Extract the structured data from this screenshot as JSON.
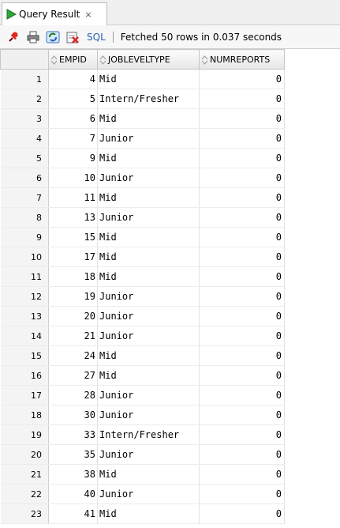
{
  "tab": {
    "title": "Query Result",
    "close_symbol": "×",
    "run_icon": "green-play-icon"
  },
  "toolbar": {
    "icons": [
      "pin-icon",
      "print-icon",
      "refresh-icon",
      "export-icon"
    ],
    "sql_label": "SQL",
    "status": "Fetched 50 rows in 0.037 seconds"
  },
  "columns": [
    "EMPID",
    "JOBLEVELTYPE",
    "NUMREPORTS"
  ],
  "rows": [
    {
      "n": "1",
      "empid": "4",
      "job": "Mid",
      "num": "0"
    },
    {
      "n": "2",
      "empid": "5",
      "job": "Intern/Fresher",
      "num": "0"
    },
    {
      "n": "3",
      "empid": "6",
      "job": "Mid",
      "num": "0"
    },
    {
      "n": "4",
      "empid": "7",
      "job": "Junior",
      "num": "0"
    },
    {
      "n": "5",
      "empid": "9",
      "job": "Mid",
      "num": "0"
    },
    {
      "n": "6",
      "empid": "10",
      "job": "Junior",
      "num": "0"
    },
    {
      "n": "7",
      "empid": "11",
      "job": "Mid",
      "num": "0"
    },
    {
      "n": "8",
      "empid": "13",
      "job": "Junior",
      "num": "0"
    },
    {
      "n": "9",
      "empid": "15",
      "job": "Mid",
      "num": "0"
    },
    {
      "n": "10",
      "empid": "17",
      "job": "Mid",
      "num": "0"
    },
    {
      "n": "11",
      "empid": "18",
      "job": "Mid",
      "num": "0"
    },
    {
      "n": "12",
      "empid": "19",
      "job": "Junior",
      "num": "0"
    },
    {
      "n": "13",
      "empid": "20",
      "job": "Junior",
      "num": "0"
    },
    {
      "n": "14",
      "empid": "21",
      "job": "Junior",
      "num": "0"
    },
    {
      "n": "15",
      "empid": "24",
      "job": "Mid",
      "num": "0"
    },
    {
      "n": "16",
      "empid": "27",
      "job": "Mid",
      "num": "0"
    },
    {
      "n": "17",
      "empid": "28",
      "job": "Junior",
      "num": "0"
    },
    {
      "n": "18",
      "empid": "30",
      "job": "Junior",
      "num": "0"
    },
    {
      "n": "19",
      "empid": "33",
      "job": "Intern/Fresher",
      "num": "0"
    },
    {
      "n": "20",
      "empid": "35",
      "job": "Junior",
      "num": "0"
    },
    {
      "n": "21",
      "empid": "38",
      "job": "Mid",
      "num": "0"
    },
    {
      "n": "22",
      "empid": "40",
      "job": "Junior",
      "num": "0"
    },
    {
      "n": "23",
      "empid": "41",
      "job": "Mid",
      "num": "0"
    }
  ]
}
